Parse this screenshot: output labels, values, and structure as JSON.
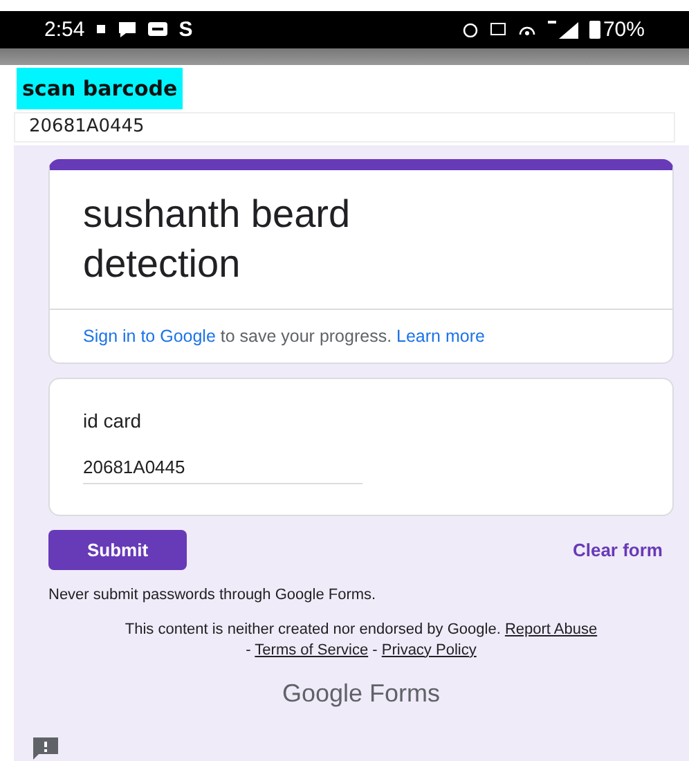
{
  "status_bar": {
    "time": "2:54",
    "app_letter": "S",
    "battery": "70%"
  },
  "scan_button": {
    "label": "scan barcode"
  },
  "barcode_field": {
    "value": "20681A0445"
  },
  "form": {
    "title": "sushanth beard detection",
    "sign_in": {
      "link": "Sign in to Google",
      "text": " to save your progress. ",
      "learn_more": "Learn more"
    },
    "question": {
      "label": "id card",
      "value": "20681A0445"
    },
    "submit": "Submit",
    "clear": "Clear form",
    "warning": "Never submit passwords through Google Forms.",
    "disclaimer": {
      "text": "This content is neither created nor endorsed by Google. ",
      "report": "Report Abuse",
      "sep": " - ",
      "terms": "Terms of Service",
      "privacy": "Privacy Policy"
    },
    "brand": "Google Forms"
  }
}
